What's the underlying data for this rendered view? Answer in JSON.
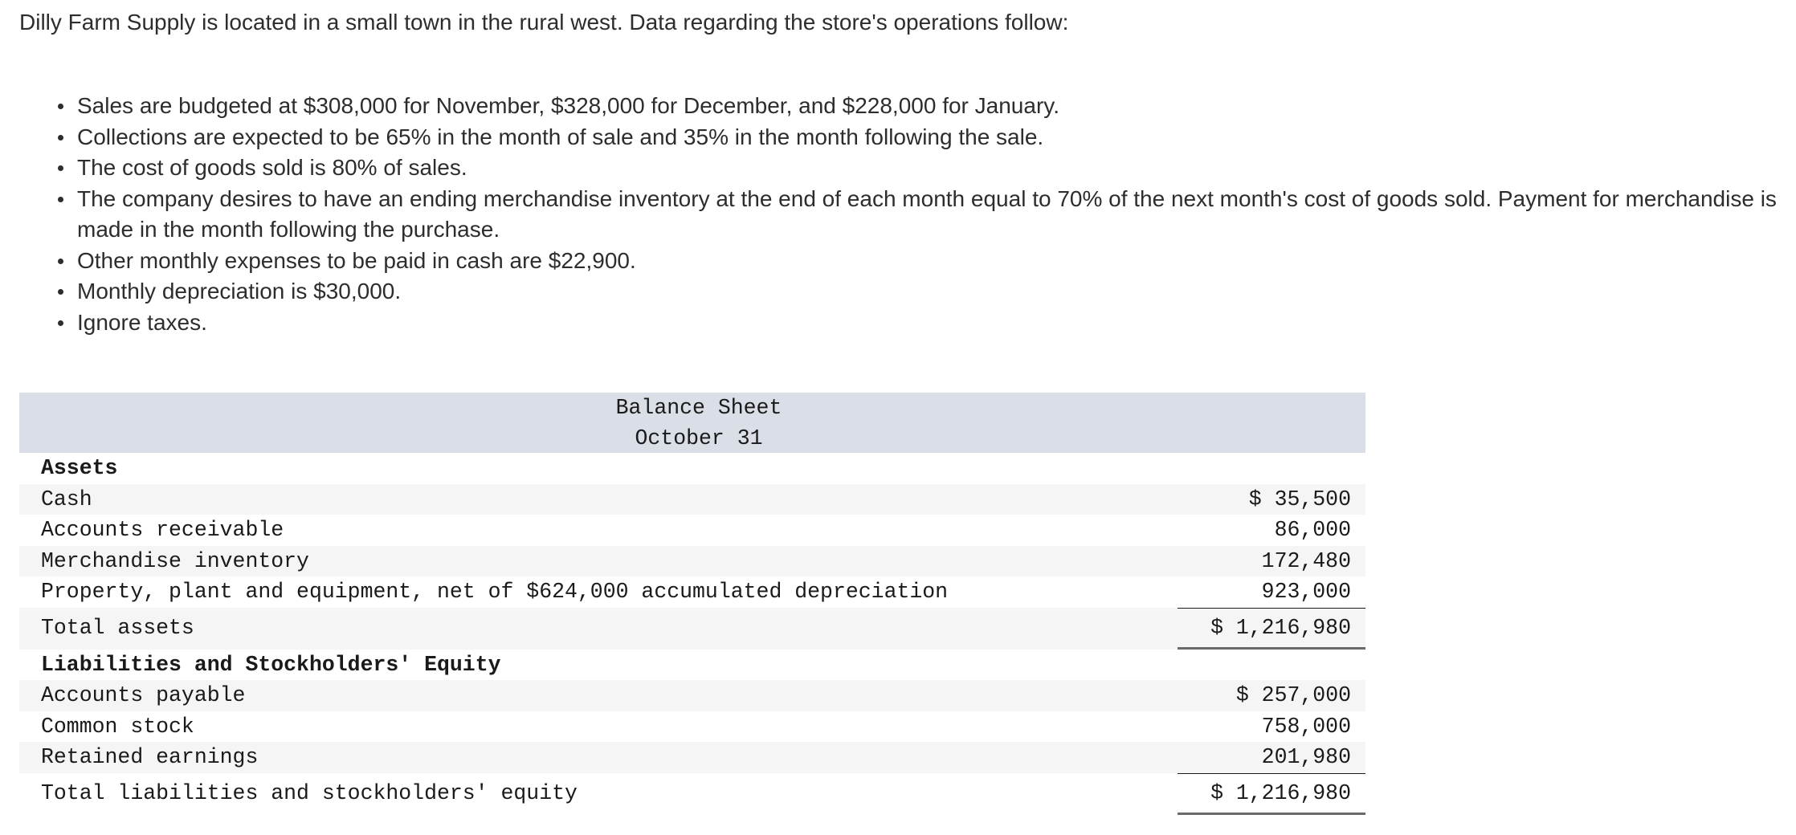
{
  "intro": "Dilly Farm Supply is located in a small town in the rural west. Data regarding the store's operations follow:",
  "bullets": [
    "Sales are budgeted at $308,000 for November, $328,000 for December, and $228,000 for January.",
    "Collections are expected to be 65% in the month of sale and 35% in the month following the sale.",
    "The cost of goods sold is 80% of sales.",
    "The company desires to have an ending merchandise inventory at the end of each month equal to 70% of the next month's cost of goods sold. Payment for merchandise is made in the month following the purchase.",
    "Other monthly expenses to be paid in cash are $22,900.",
    "Monthly depreciation is $30,000.",
    "Ignore taxes."
  ],
  "balance_sheet": {
    "title": "Balance Sheet",
    "date": "October 31",
    "assets_heading": "Assets",
    "assets": [
      {
        "label": "Cash",
        "amount": "$ 35,500"
      },
      {
        "label": "Accounts receivable",
        "amount": "86,000"
      },
      {
        "label": "Merchandise inventory",
        "amount": "172,480"
      },
      {
        "label": "Property, plant and equipment, net of $624,000 accumulated depreciation",
        "amount": "923,000"
      }
    ],
    "total_assets": {
      "label": "Total assets",
      "amount": "$ 1,216,980"
    },
    "liabilities_heading": "Liabilities and Stockholders' Equity",
    "liabilities": [
      {
        "label": "Accounts payable",
        "amount": "$ 257,000"
      },
      {
        "label": "Common stock",
        "amount": "758,000"
      },
      {
        "label": "Retained earnings",
        "amount": "201,980"
      }
    ],
    "total_liabilities": {
      "label": "Total liabilities and stockholders' equity",
      "amount": "$ 1,216,980"
    }
  }
}
